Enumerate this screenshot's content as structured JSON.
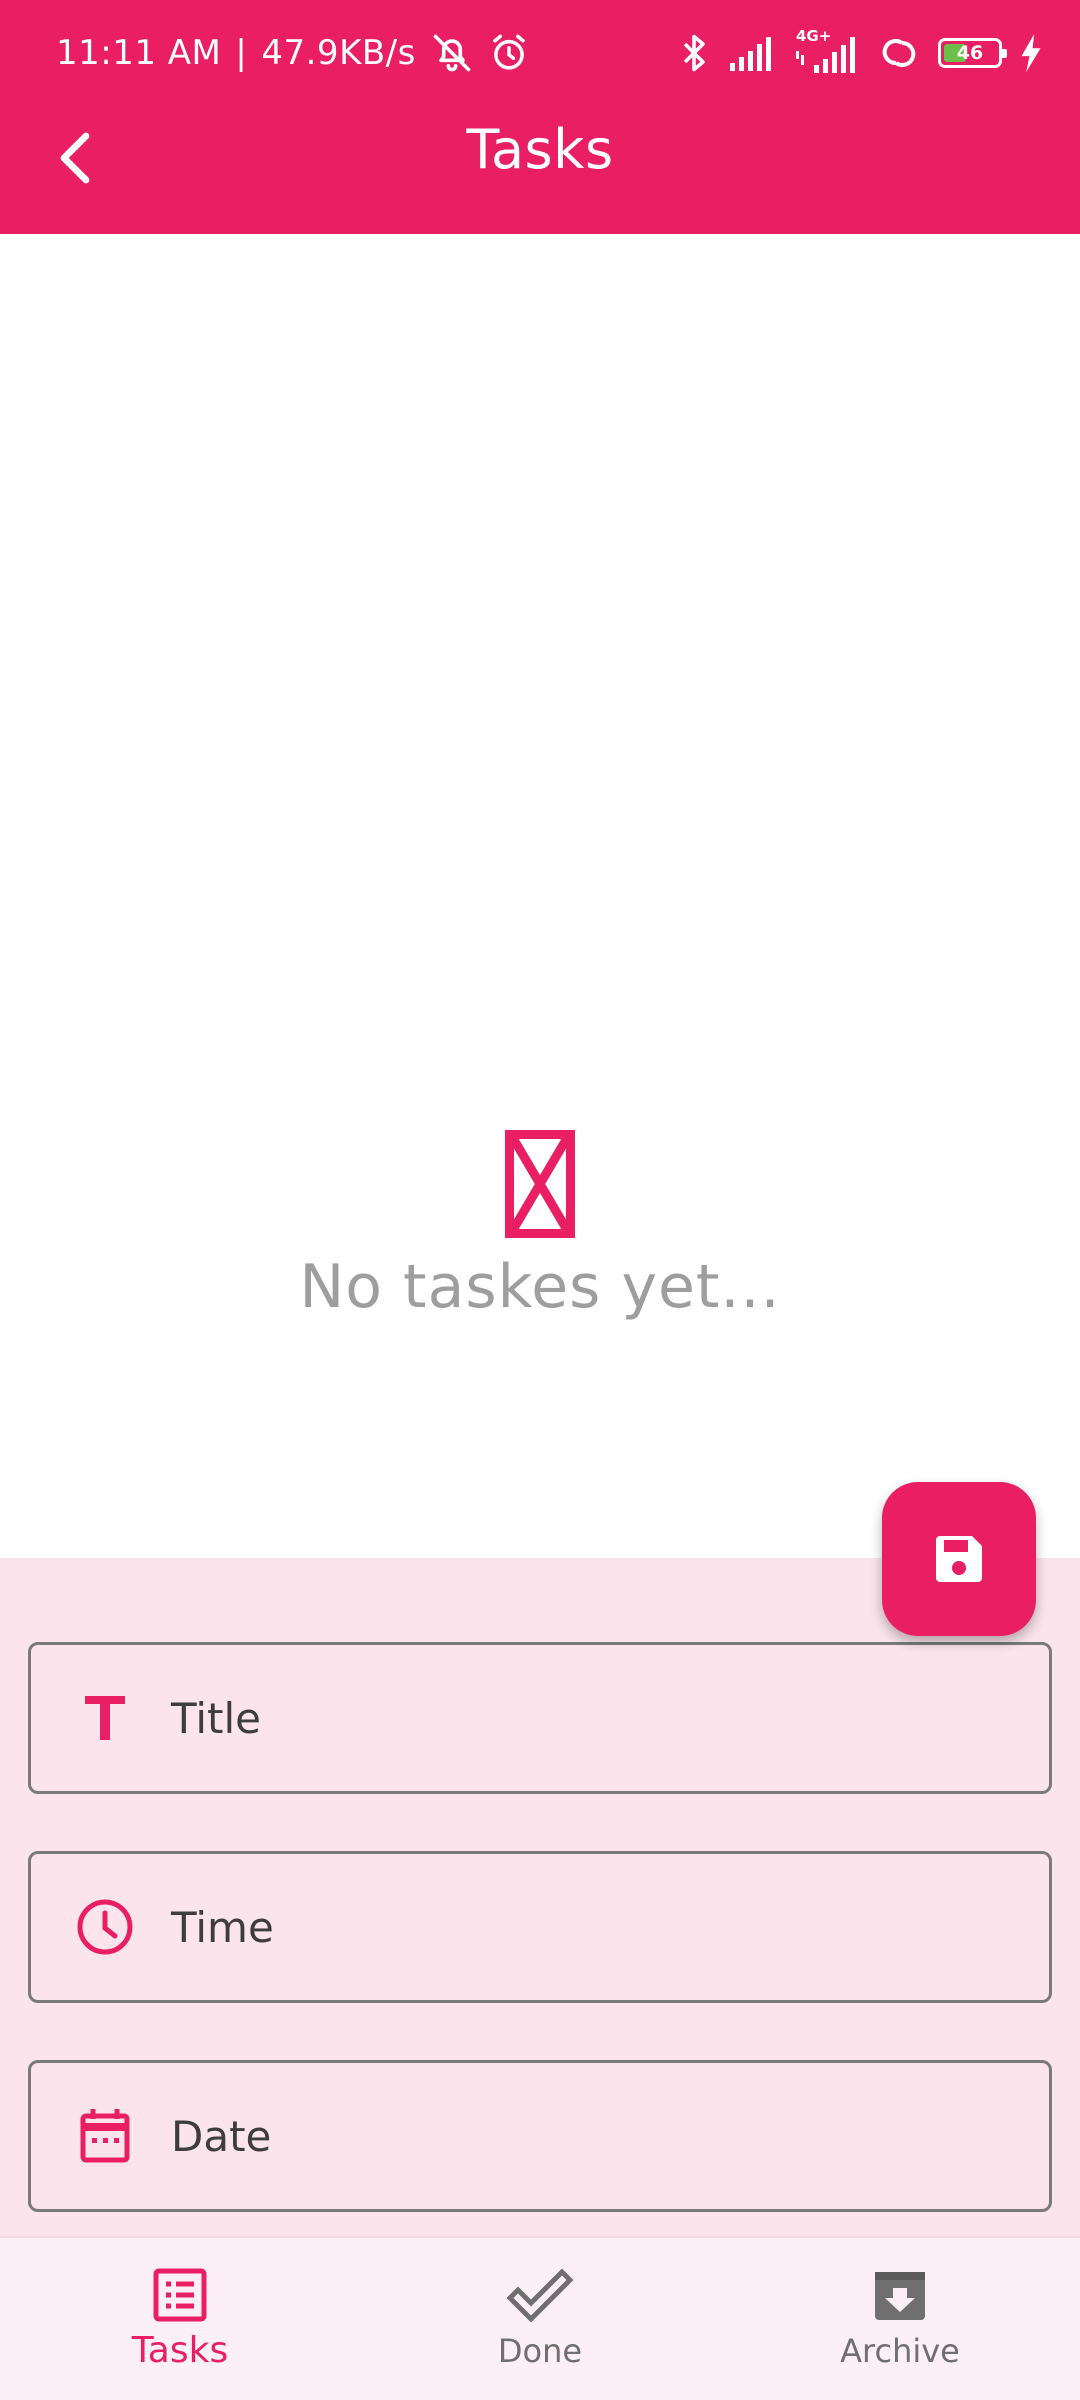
{
  "status_bar": {
    "time": "11:11 AM",
    "separator": "|",
    "net_speed": "47.9KB/s",
    "network_type": "4G+",
    "battery_level": "46",
    "icons": [
      "bell-muted-icon",
      "alarm-icon",
      "bluetooth-icon",
      "signal-icon",
      "signal-4g-icon",
      "link-icon",
      "battery-icon",
      "charging-icon"
    ]
  },
  "app_bar": {
    "title": "Tasks",
    "back_icon": "chevron-left-icon"
  },
  "empty_state": {
    "icon": "hourglass-icon",
    "message": "No taskes yet..."
  },
  "form": {
    "fields": [
      {
        "label": "Title",
        "icon": "title-icon"
      },
      {
        "label": "Time",
        "icon": "clock-icon"
      },
      {
        "label": "Date",
        "icon": "calendar-icon"
      }
    ],
    "fab_icon": "save-icon"
  },
  "bottom_nav": {
    "items": [
      {
        "label": "Tasks",
        "icon": "list-icon",
        "active": true
      },
      {
        "label": "Done",
        "icon": "check-icon",
        "active": false
      },
      {
        "label": "Archive",
        "icon": "archive-icon",
        "active": false
      }
    ]
  },
  "colors": {
    "primary": "#E91E63",
    "sheet_background": "#FBE4EC",
    "nav_background": "#FCF0F6",
    "inactive": "#6f6f6f",
    "empty_text": "#9E9E9E",
    "battery_fill": "#6CC04A"
  }
}
